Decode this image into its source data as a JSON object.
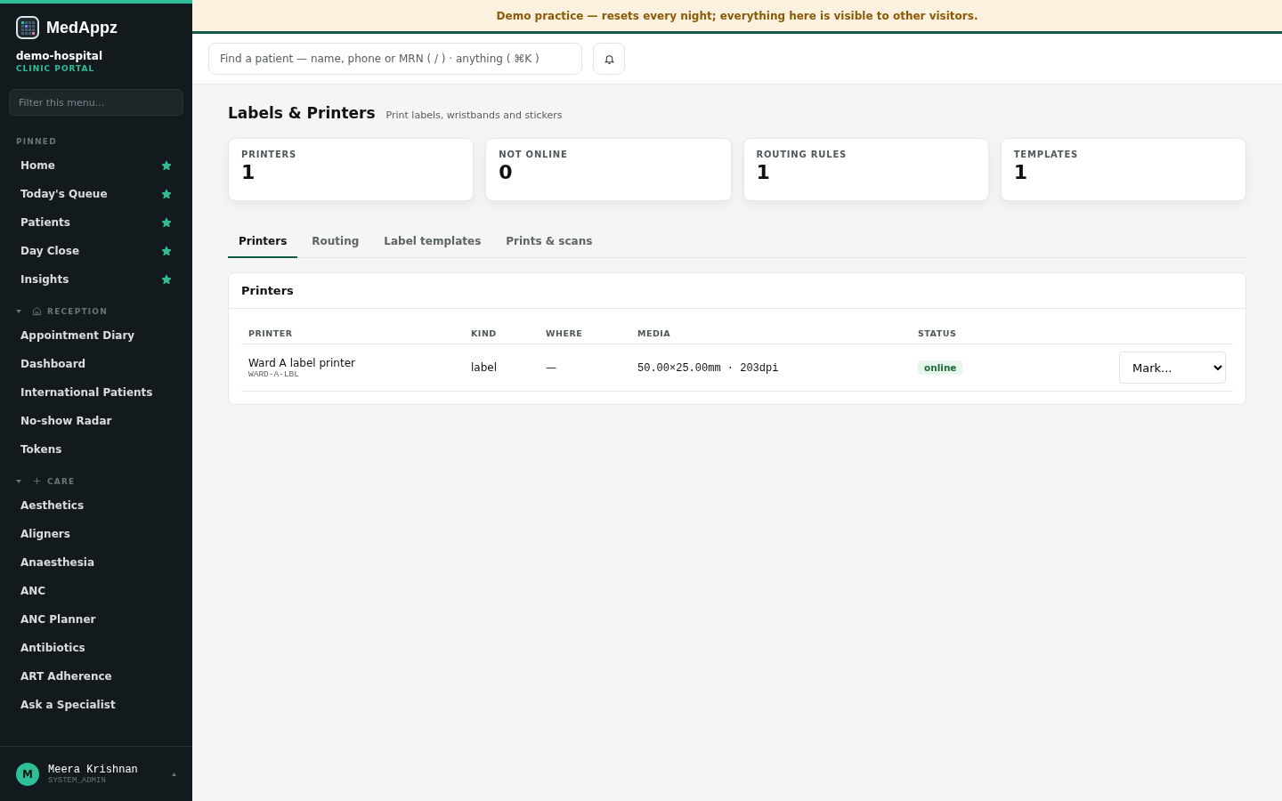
{
  "banner": "Demo practice — resets every night; everything here is visible to other visitors.",
  "sidebar": {
    "brand": "MedAppz",
    "org": "demo-hospital",
    "portal": "CLINIC PORTAL",
    "filter": {
      "placeholder": "Filter this menu..."
    },
    "pinned": {
      "title": "PINNED",
      "items": [
        {
          "label": "Home",
          "starred": true
        },
        {
          "label": "Today's Queue",
          "starred": true
        },
        {
          "label": "Patients",
          "starred": true
        },
        {
          "label": "Day Close",
          "starred": true
        },
        {
          "label": "Insights",
          "starred": true
        }
      ]
    },
    "sections": [
      {
        "title": "RECEPTION",
        "expanded": true,
        "items": [
          "Appointment Diary",
          "Dashboard",
          "International Patients",
          "No-show Radar",
          "Tokens"
        ]
      },
      {
        "title": "CARE",
        "expanded": true,
        "items": [
          "Aesthetics",
          "Aligners",
          "Anaesthesia",
          "ANC",
          "ANC Planner",
          "Antibiotics",
          "ART Adherence",
          "Ask a Specialist"
        ]
      }
    ],
    "user": {
      "initial": "M",
      "name": "Meera Krishnan",
      "role": "SYSTEM_ADMIN"
    }
  },
  "search": {
    "placeholder": "Find a patient — name, phone or MRN ( / ) · anything ( ⌘K )"
  },
  "page": {
    "title": "Labels & Printers",
    "subtitle": "Print labels, wristbands and stickers"
  },
  "stats": [
    {
      "label": "PRINTERS",
      "value": "1"
    },
    {
      "label": "NOT ONLINE",
      "value": "0"
    },
    {
      "label": "ROUTING RULES",
      "value": "1"
    },
    {
      "label": "TEMPLATES",
      "value": "1"
    }
  ],
  "tabs": [
    {
      "label": "Printers",
      "selected": true
    },
    {
      "label": "Routing",
      "selected": false
    },
    {
      "label": "Label templates",
      "selected": false
    },
    {
      "label": "Prints & scans",
      "selected": false
    }
  ],
  "panel": {
    "title": "Printers",
    "columns": [
      "PRINTER",
      "KIND",
      "WHERE",
      "MEDIA",
      "STATUS"
    ],
    "rows": [
      {
        "name": "Ward A label printer",
        "code": "WARD-A-LBL",
        "kind": "label",
        "where": "—",
        "media": "50.00×25.00mm · 203dpi",
        "status": "online",
        "action": "Mark..."
      }
    ]
  }
}
